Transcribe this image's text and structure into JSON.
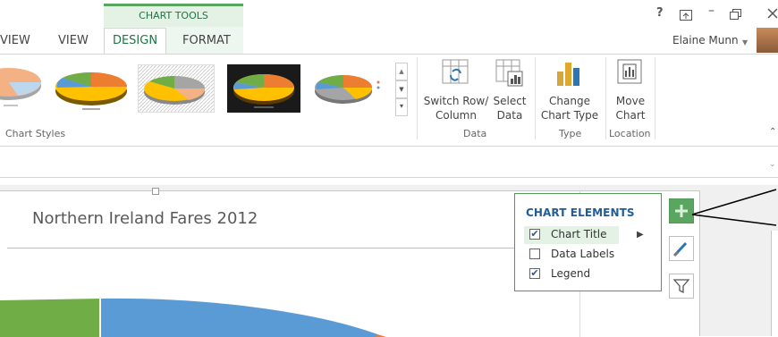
{
  "tabs": [
    {
      "label": "VIEW",
      "partial": true
    },
    {
      "label": "VIEW"
    },
    {
      "label": "DESIGN",
      "active": true
    },
    {
      "label": "FORMAT"
    }
  ],
  "context_header": "CHART TOOLS",
  "window_controls": {
    "help": "?",
    "minimize": "–"
  },
  "user": {
    "name": "Elaine Munn"
  },
  "ribbon": {
    "chart_styles_label": "Chart Styles",
    "buttons": {
      "switch_row_col": [
        "Switch Row/",
        "Column"
      ],
      "select_data": [
        "Select",
        "Data"
      ],
      "change_chart_type": [
        "Change",
        "Chart Type"
      ],
      "move_chart": [
        "Move",
        "Chart"
      ]
    },
    "groups": {
      "data": "Data",
      "type": "Type",
      "location": "Location"
    }
  },
  "chart": {
    "title": "Northern Ireland Fares 2012"
  },
  "chart_elements": {
    "heading": "CHART ELEMENTS",
    "items": [
      {
        "label": "Chart Title",
        "checked": true,
        "highlighted": true
      },
      {
        "label": "Data Labels",
        "checked": false
      },
      {
        "label": "Legend",
        "checked": true
      }
    ]
  },
  "colors": {
    "accent_green": "#217346",
    "pie_blue": "#5b9bd5",
    "pie_green": "#70ad47",
    "pie_orange": "#ed7d31",
    "pie_yellow": "#ffc000",
    "pie_gray": "#a5a5a5"
  }
}
